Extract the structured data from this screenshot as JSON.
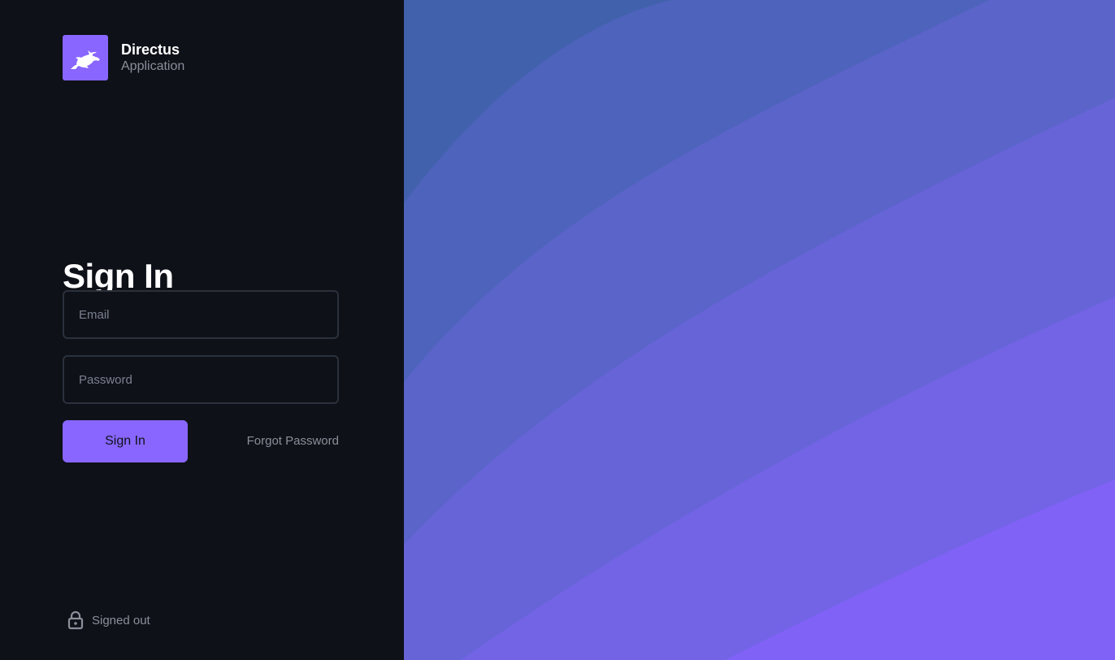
{
  "brand": {
    "title": "Directus",
    "subtitle": "Application",
    "logo_icon": "rabbit-icon",
    "accent_color": "#8866ff"
  },
  "signin": {
    "heading": "Sign In",
    "email_placeholder": "Email",
    "email_value": "",
    "password_placeholder": "Password",
    "password_value": "",
    "submit_label": "Sign In",
    "forgot_label": "Forgot Password"
  },
  "status": {
    "icon": "lock-icon",
    "text": "Signed out"
  },
  "colors": {
    "background": "#0e1118",
    "accent": "#8866ff",
    "field_border": "#2b313c",
    "muted_text": "#8a8f9a",
    "gradient_stops": [
      "#4161ad",
      "#8866ff"
    ]
  }
}
